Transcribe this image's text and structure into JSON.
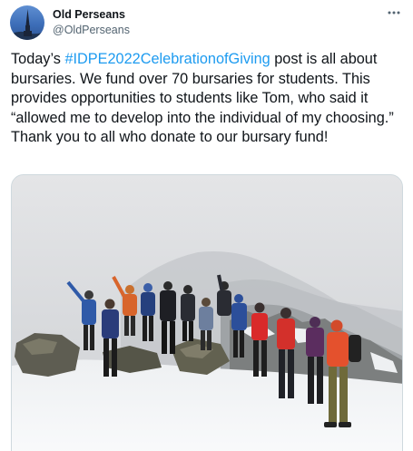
{
  "account": {
    "display_name": "Old Perseans",
    "handle": "@OldPerseans"
  },
  "tweet": {
    "text_before": "Today’s ",
    "hashtag": "#IDPE2022CelebrationofGiving",
    "text_after": " post is all about bursaries. We fund over 70 bursaries for students. This provides opportunities to students like Tom, who said it “allowed me to develop into the individual of my choosing.” Thank you to all who donate to our bursary fund!"
  },
  "icons": {
    "more": "more-options-icon",
    "avatar": "spire-logo"
  },
  "colors": {
    "link": "#1d9bf0",
    "text": "#0f1419",
    "secondary": "#536471",
    "avatar_bg": "#4a7bc6"
  }
}
